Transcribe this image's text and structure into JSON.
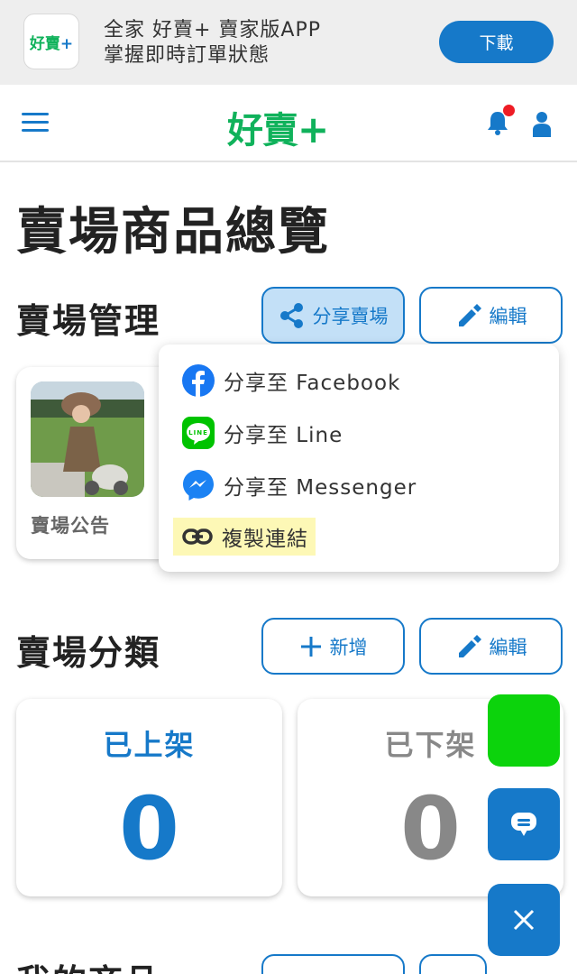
{
  "banner": {
    "icon_text": "好賣",
    "icon_plus": "+",
    "line1": "全家 好賣+ 賣家版APP",
    "line2": "掌握即時訂單狀態",
    "download_label": "下載"
  },
  "header": {
    "logo_text": "好賣",
    "logo_plus": "+",
    "menu_icon": "hamburger-menu-icon",
    "notification_icon": "bell-icon",
    "account_icon": "user-icon"
  },
  "page_title": "賣場商品總覽",
  "store_section": {
    "title": "賣場管理",
    "share_label": "分享賣場",
    "edit_label": "編輯",
    "card_label": "賣場公告"
  },
  "share_menu": {
    "items": [
      {
        "label": "分享至 Facebook",
        "icon": "facebook-icon"
      },
      {
        "label": "分享至 Line",
        "icon": "line-icon"
      },
      {
        "label": "分享至 Messenger",
        "icon": "messenger-icon"
      },
      {
        "label": "複製連結",
        "icon": "link-icon"
      }
    ]
  },
  "category_section": {
    "title": "賣場分類",
    "add_label": "新增",
    "edit_label": "編輯"
  },
  "stats": {
    "listed_label": "已上架",
    "listed_value": "0",
    "unlisted_label": "已下架",
    "unlisted_value": "0"
  },
  "bottom_section": {
    "title_partial": "我的商品"
  },
  "colors": {
    "accent": "#1679c9",
    "brand_green": "#10b25b",
    "line_green": "#00c300",
    "highlight": "#fdf8b6",
    "notification_dot": "#ee1c25",
    "muted_gray": "#888888"
  }
}
